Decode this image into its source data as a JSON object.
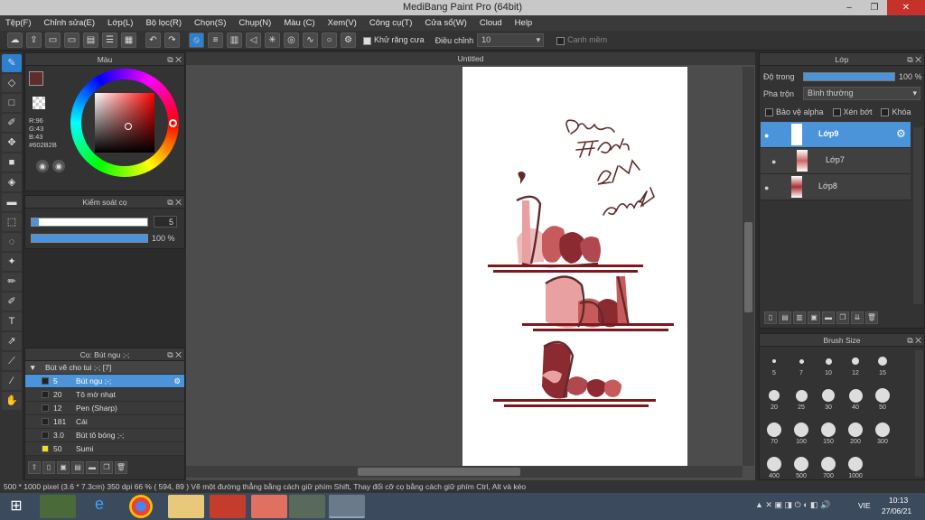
{
  "window": {
    "title": "MediBang Paint Pro (64bit)",
    "minimize": "‒",
    "restore": "❐",
    "close": "✕"
  },
  "menu": [
    "Tệp(F)",
    "Chỉnh sửa(E)",
    "Lớp(L)",
    "Bộ lọc(R)",
    "Chọn(S)",
    "Chụp(N)",
    "Màu (C)",
    "Xem(V)",
    "Công cụ(T)",
    "Cửa sổ(W)",
    "Cloud",
    "Help"
  ],
  "toolbar": {
    "antialias_label": "Khử răng cưa",
    "adjust_label": "Điều chỉnh",
    "adjust_value": "10",
    "snap_label": "Canh mềm"
  },
  "color_panel": {
    "title": "Màu",
    "r": "R:96",
    "g": "G:43",
    "b": "B:43",
    "hex": "#602B2B",
    "fg_color": "#602b2b"
  },
  "brush_control": {
    "title": "Kiểm soát cọ",
    "size": "5",
    "opacity": "100 %"
  },
  "brush_panel": {
    "title": "Cọ: Bút ngu ;-;",
    "group": "Bút vẽ cho tui ;-; [7]",
    "items": [
      {
        "size": "5",
        "name": "Bút ngu ;-;",
        "selected": true
      },
      {
        "size": "20",
        "name": "Tô mờ nhạt"
      },
      {
        "size": "12",
        "name": "Pen (Sharp)"
      },
      {
        "size": "181",
        "name": "Cái"
      },
      {
        "size": "3.0",
        "name": "Bút tô bóng ;-;"
      },
      {
        "size": "50",
        "name": "Sumi"
      }
    ]
  },
  "canvas": {
    "tab": "Untitled"
  },
  "layer_panel": {
    "title": "Lớp",
    "opacity_label": "Độ trong",
    "opacity_value": "100 %",
    "blend_label": "Pha trộn",
    "blend_value": "Bình thường",
    "protect_alpha": "Bảo vệ alpha",
    "clipping": "Xén bớt",
    "lock": "Khóa",
    "layers": [
      {
        "name": "Lớp9",
        "selected": true
      },
      {
        "name": "Lớp7"
      },
      {
        "name": "Lớp8"
      }
    ]
  },
  "brush_size": {
    "title": "Brush Size",
    "sizes": [
      "5",
      "7",
      "10",
      "12",
      "15",
      "20",
      "25",
      "30",
      "40",
      "50",
      "70",
      "100",
      "150",
      "200",
      "300",
      "400",
      "500",
      "700",
      "1000"
    ]
  },
  "status": "500 * 1000 pixel  (3.6 * 7.3cm)  350 dpi  66 %  ( 594, 89 )  Vẽ một đường thẳng bằng cách giữ phím Shift, Thay đổi cỡ cọ bằng cách giữ phím Ctrl, Alt và kéo",
  "taskbar": {
    "lang": "VIE",
    "time": "10:13",
    "date": "27/06/21"
  },
  "colors": {
    "accent": "#4c94da",
    "ink": "#602b2b",
    "pink": "#e8a0a0"
  }
}
